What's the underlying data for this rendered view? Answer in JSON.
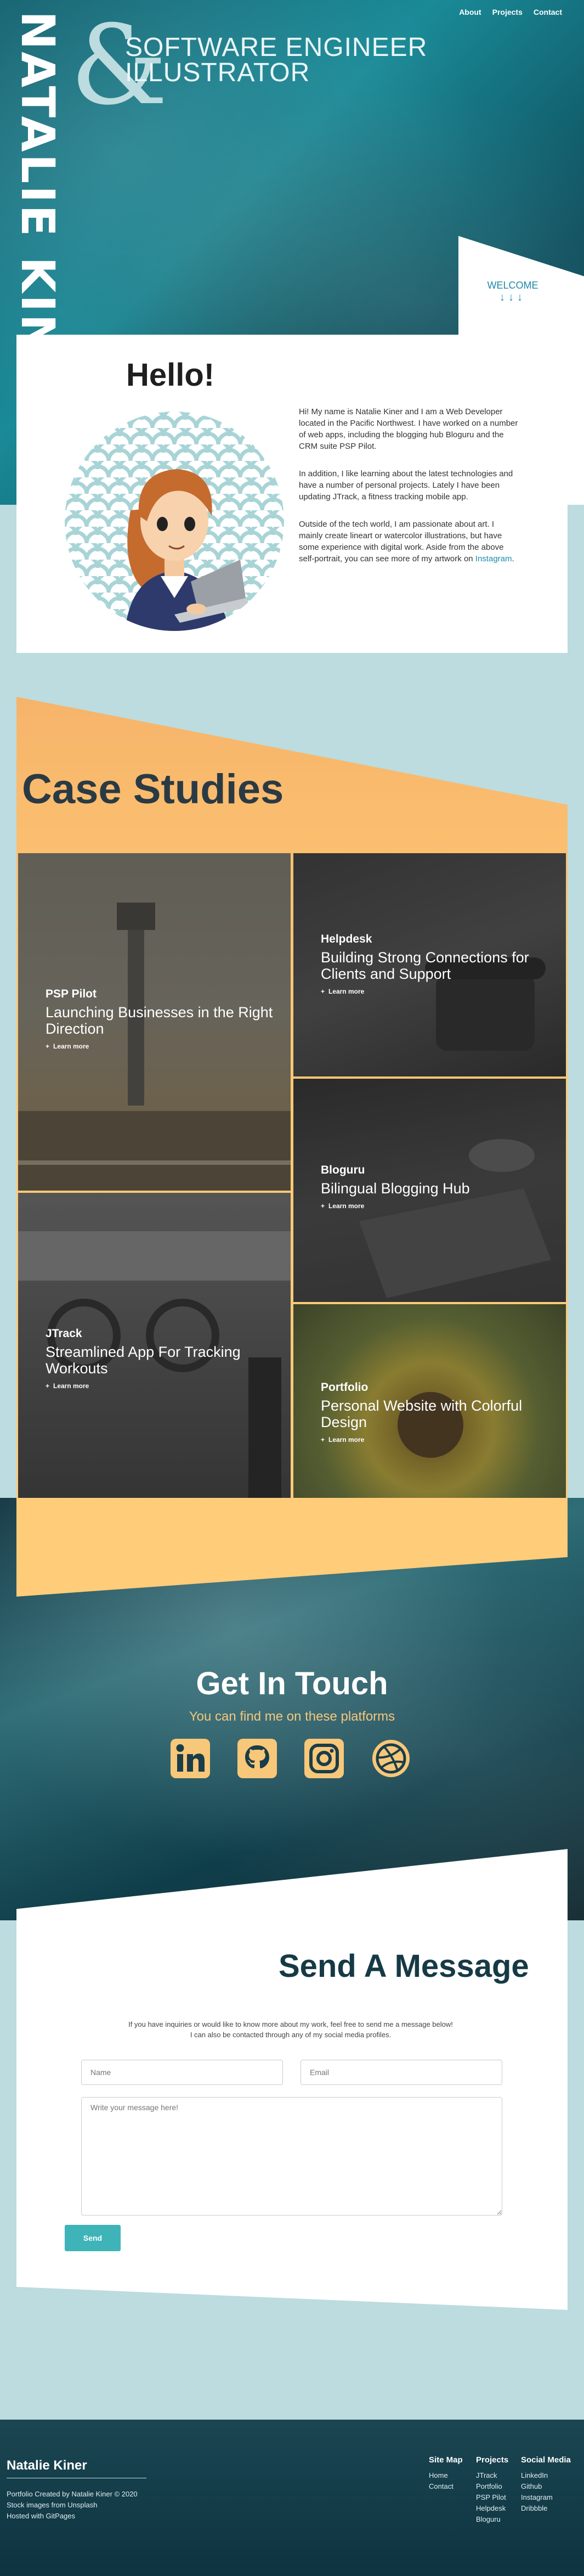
{
  "nav": {
    "items": [
      "About",
      "Projects",
      "Contact"
    ]
  },
  "hero": {
    "name": "NATALIE KINER",
    "amp": "&",
    "tagline_1": "SOFTWARE ENGINEER",
    "tagline_2": "ILLUSTRATOR",
    "welcome": "WELCOME",
    "arrows": "↓↓↓"
  },
  "about": {
    "heading": "Hello!",
    "p1": "Hi! My name is Natalie Kiner and I am a Web Developer located in the Pacific Northwest. I have worked on a number of web apps, including the blogging hub Bloguru and the CRM suite PSP Pilot.",
    "p2": "In addition, I like learning about the latest technologies and have a number of personal projects. Lately I have been updating JTrack, a fitness tracking mobile app.",
    "p3": "Outside of the tech world, I am passionate about art. I mainly create lineart or watercolor illustrations, but have some experience with digital work. Aside from the above self-portrait, you can see more of my artwork on",
    "p3_link": "Instagram",
    "p3_end": "."
  },
  "case_studies": {
    "title": "Case Studies",
    "learn_more": "Learn more",
    "items": [
      {
        "name": "PSP Pilot",
        "desc": "Launching Businesses in the Right Direction"
      },
      {
        "name": "Helpdesk",
        "desc": "Building Strong Connections for Clients and Support"
      },
      {
        "name": "Bloguru",
        "desc": "Bilingual Blogging Hub"
      },
      {
        "name": "JTrack",
        "desc": "Streamlined App For Tracking Workouts"
      },
      {
        "name": "Portfolio",
        "desc": "Personal Website with Colorful Design"
      }
    ]
  },
  "contact": {
    "heading": "Get In Touch",
    "subheading": "You can find me on these platforms",
    "icons": [
      "linkedin-icon",
      "github-icon",
      "instagram-icon",
      "dribbble-icon"
    ],
    "accent": "#f7c77a"
  },
  "message": {
    "heading": "Send A Message",
    "intro_1": "If you have inquiries or would like to know more about my work, feel free to send me a message below!",
    "intro_2": "I can also be contacted through any of my social media profiles.",
    "name_placeholder": "Name",
    "email_placeholder": "Email",
    "message_placeholder": "Write your message here!",
    "send_label": "Send"
  },
  "footer": {
    "title": "Natalie Kiner",
    "info": [
      "Portfolio Created by Natalie Kiner © 2020",
      "Stock images from Unsplash",
      "Hosted with GitPages"
    ],
    "columns": [
      {
        "heading": "Site Map",
        "links": [
          "Home",
          "Contact"
        ]
      },
      {
        "heading": "Projects",
        "links": [
          "JTrack",
          "Portfolio",
          "PSP Pilot",
          "Helpdesk",
          "Bloguru"
        ]
      },
      {
        "heading": "Social Media",
        "links": [
          "LinkedIn",
          "Github",
          "Instagram",
          "Dribbble"
        ]
      }
    ]
  }
}
